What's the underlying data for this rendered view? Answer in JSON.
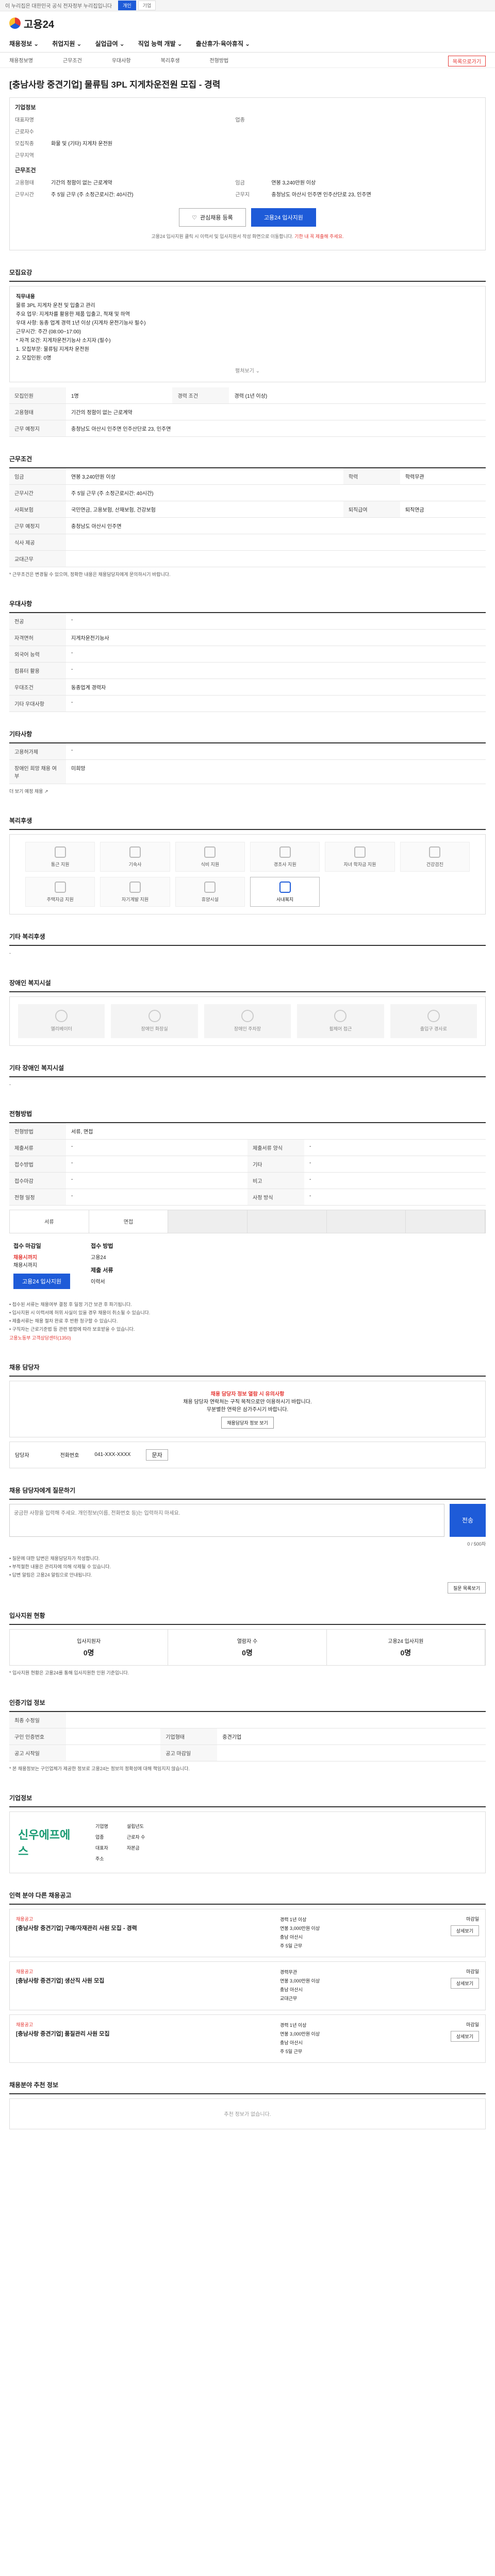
{
  "topbar": {
    "text": "이 누리집은 대한민국 공식 전자정부 누리집입니다",
    "tabs": [
      "개인",
      "기업"
    ]
  },
  "logo": "고용24",
  "gnb": [
    "채용정보",
    "취업지원",
    "실업급여",
    "직업 능력 개발",
    "출산휴가·육아휴직"
  ],
  "subnav": {
    "items": [
      "채용정보명",
      "근무조건",
      "우대사항",
      "복리후생",
      "전형방법"
    ],
    "cta": "목록으로가기"
  },
  "job_title": "[충남사랑 중견기업] 물류팀 3PL 지게차운전원 모집 - 경력",
  "summary": {
    "company_section": "기업정보",
    "rows": [
      {
        "k": "대표자명",
        "v": "",
        "k2": "업종",
        "v2": ""
      },
      {
        "k": "근로자수",
        "v": "",
        "k2": "",
        "v2": ""
      },
      {
        "k": "모집직종",
        "v": "화물 및 (기타) 지게차 운전원",
        "k2": "",
        "v2": ""
      },
      {
        "k": "근무지역",
        "v": "",
        "k2": "",
        "v2": ""
      }
    ],
    "cond_section": "근무조건",
    "cond_rows": [
      {
        "k": "고용형태",
        "v": "기간의 정함이 없는 근로계약",
        "k2": "임금",
        "v2": "연봉 3,240만원 이상"
      },
      {
        "k": "근무시간",
        "v": "주 5일 근무 (주 소정근로시간: 40시간)",
        "k2": "근무지",
        "v2": "충청남도 아산시 인주면 인주산단로 23, 인주면"
      }
    ]
  },
  "buttons": {
    "interest": "관심채용 등록",
    "apply": "고용24 입사지원"
  },
  "apply_note": "고용24 입사지원 클릭 시 이력서 및 입사지원서 작성 화면으로 이동합니다.",
  "apply_note_red": "기한 내 꼭 제출해 주세요.",
  "sections": {
    "recruit": "모집요강",
    "work": "근무조건",
    "preference": "우대사항",
    "welfare": "복리후생",
    "welfare_etc": "기타 복리후생",
    "disability": "장애인 복지시설",
    "disability_etc": "기타 장애인 복지시설",
    "process": "전형방법",
    "contact": "채용 담당자",
    "inquiry": "채용 담당자에게 질문하기",
    "stats": "입사지원 현황",
    "info": "인증기업 정보",
    "company": "기업정보",
    "other": "인력 분야 다른 채용공고",
    "recommend": "채용분야 추천 정보"
  },
  "recruit_box": {
    "lines": [
      "직무내용",
      "물류 3PL 지게차 운전 및 입출고 관리",
      "주요 업무: 지게차를 활용한 제품 입출고, 적재 및 하역",
      "우대 사항: 동종 업계 경력 1년 이상 (지게차 운전기능사 필수)",
      "근무시간: 주간 (08:00~17:00)",
      "* 자격 요건: 지게차운전기능사 소지자 (필수)",
      "1. 모집부문: 물류팀 지게차 운전원",
      "2. 모집인원: 0명"
    ],
    "more": "펼쳐보기"
  },
  "work_rows": [
    {
      "k": "모집인원",
      "v": "1명",
      "k2": "경력 조건",
      "v2": "경력 (1년 이상)"
    },
    {
      "k": "고용형태",
      "v": "기간의 정함이 없는 근로계약",
      "k2": "",
      "v2": ""
    },
    {
      "k": "근무 예정지",
      "v": "충청남도 아산시 인주면 인주산단로 23, 인주면",
      "k2": "",
      "v2": ""
    },
    {
      "k": "임금",
      "v": "연봉 3,240만원 이상",
      "k2": "학력",
      "v2": "학력무관"
    },
    {
      "k": "근무시간",
      "v": "주 5일 근무 (주 소정근로시간: 40시간)",
      "k2": "",
      "v2": ""
    },
    {
      "k": "사회보험",
      "v": "국민연금, 고용보험, 산재보험, 건강보험",
      "k2": "퇴직급여",
      "v2": "퇴직연금"
    },
    {
      "k": "근무 예정지",
      "v": "충청남도 아산시 인주면",
      "k2": "",
      "v2": ""
    },
    {
      "k": "식사 제공",
      "v": "",
      "k2": "",
      "v2": ""
    },
    {
      "k": "교대근무",
      "v": "",
      "k2": "",
      "v2": ""
    }
  ],
  "work_footnote": "* 근무조건은 변경될 수 있으며, 정확한 내용은 채용담당자에게 문의하시기 바랍니다.",
  "preference_rows": [
    {
      "k": "전공",
      "v": "-"
    },
    {
      "k": "자격면허",
      "v": "지게차운전기능사"
    },
    {
      "k": "외국어 능력",
      "v": "-"
    },
    {
      "k": "컴퓨터 활용",
      "v": "-"
    },
    {
      "k": "우대조건",
      "v": "동종업계 경력자"
    },
    {
      "k": "기타 우대사항",
      "v": "-"
    }
  ],
  "extra_section": "기타사항",
  "extra_rows": [
    {
      "k": "고용허가제",
      "v": "-"
    },
    {
      "k": "장애인 희망 채용 여부",
      "v": "미희망"
    }
  ],
  "extra_link": "더 보기 예정 채용",
  "welfare_items": [
    "통근 지원",
    "기숙사",
    "식비 지원",
    "경조사 지원",
    "자녀 학자금 지원",
    "건강검진",
    "주택자금 지원",
    "자기계발 지원",
    "휴양시설",
    "사내복지"
  ],
  "welfare_etc_value": "-",
  "disability_items": [
    "엘리베이터",
    "장애인 화장실",
    "장애인 주차장",
    "휠체어 접근",
    "출입구 경사로"
  ],
  "disability_etc_value": "-",
  "process": {
    "rows": [
      {
        "k": "전형방법",
        "v": "서류, 면접",
        "k2": "",
        "v2": ""
      },
      {
        "k": "제출서류",
        "v": "-",
        "k2": "제출서류 양식",
        "v2": "-"
      },
      {
        "k": "접수방법",
        "v": "-",
        "k2": "기타",
        "v2": "-"
      },
      {
        "k": "접수마감",
        "v": "-",
        "k2": "비고",
        "v2": "-"
      },
      {
        "k": "전형 일정",
        "v": "-",
        "k2": "사정 방식",
        "v2": "-"
      }
    ],
    "steps": [
      "서류",
      "면접",
      "",
      "",
      "",
      ""
    ]
  },
  "apply": {
    "period_label": "접수 마감일",
    "period_value": "채용시까지",
    "period_sub": "채용시까지",
    "method_label": "접수 방법",
    "method_value": "고용24",
    "submit_label": "제출 서류",
    "submit_value": "이력서",
    "btn": "고용24 입사지원"
  },
  "bullets": [
    "• 접수된 서류는 채용여부 결정 후 일정 기간 보관 후 파기됩니다.",
    "• 입사지원 시 이력서에 허위 사실이 있을 경우 채용이 취소될 수 있습니다.",
    "• 제출서류는 채용 절차 완료 후 반환 청구할 수 있습니다.",
    "• 구직자는 근로기준법 등 관련 법령에 따라 보호받을 수 있습니다."
  ],
  "bullet_red": "고용노동부 고객상담센터(1350)",
  "alert": {
    "red": "채용 담당자 정보 열람 시 유의사항",
    "text": "채용 담당자 연락처는 구직 목적으로만 이용하시기 바랍니다.",
    "text2": "무분별한 연락은 삼가주시기 바랍니다.",
    "btn": "채용담당자 정보 보기"
  },
  "contact": {
    "name_label": "담당자",
    "name_value": "",
    "phone_label": "전화번호",
    "phone_value": "041-XXX-XXXX",
    "btn": "문자"
  },
  "inquiry": {
    "placeholder": "궁금한 사항을 입력해 주세요. 개인정보(이름, 전화번호 등)는 입력하지 마세요.",
    "send": "전송",
    "counter": "0 / 500자",
    "notes": [
      "• 질문에 대한 답변은 채용담당자가 작성합니다.",
      "• 부적절한 내용은 관리자에 의해 삭제될 수 있습니다.",
      "• 답변 알림은 고용24 알림으로 안내됩니다."
    ],
    "btn": "질문 목록보기"
  },
  "stats": [
    {
      "label": "입사지원자",
      "value": "0명"
    },
    {
      "label": "열람자 수",
      "value": "0명"
    },
    {
      "label": "고용24 입사지원",
      "value": "0명"
    }
  ],
  "stats_note": "* 입사지원 현황은 고용24를 통해 입사지원한 인원 기준입니다.",
  "info_rows": [
    {
      "k": "최종 수정일",
      "v": "",
      "k2": "",
      "v2": ""
    },
    {
      "k": "구인 인증번호",
      "v": "",
      "k2": "기업형태",
      "v2": "중견기업"
    },
    {
      "k": "공고 시작일",
      "v": "",
      "k2": "공고 마감일",
      "v2": ""
    }
  ],
  "info_note": "* 본 채용정보는 구인업체가 제공한 정보로 고용24는 정보의 정확성에 대해 책임지지 않습니다.",
  "company": {
    "logo": "신우에프에스",
    "rows": [
      {
        "k": "기업명",
        "v": "",
        "k2": "설립년도",
        "v2": ""
      },
      {
        "k": "업종",
        "v": "",
        "k2": "근로자 수",
        "v2": ""
      },
      {
        "k": "대표자",
        "v": "",
        "k2": "자본금",
        "v2": ""
      },
      {
        "k": "주소",
        "v": "",
        "k2": "",
        "v2": ""
      }
    ]
  },
  "jobs": [
    {
      "co": "채용공고",
      "title": "[충남사랑 중견기업] 구매/자재관리 사원 모집 - 경력",
      "mid1": "경력 1년 이상",
      "mid2": "연봉 3,000만원 이상",
      "mid3": "충남 아산시",
      "mid4": "주 5일 근무",
      "status": "마감일",
      "btn": "상세보기"
    },
    {
      "co": "채용공고",
      "title": "[충남사랑 중견기업] 생산직 사원 모집",
      "mid1": "경력무관",
      "mid2": "연봉 3,000만원 이상",
      "mid3": "충남 아산시",
      "mid4": "교대근무",
      "status": "마감일",
      "btn": "상세보기"
    },
    {
      "co": "채용공고",
      "title": "[충남사랑 중견기업] 품질관리 사원 모집",
      "mid1": "경력 1년 이상",
      "mid2": "연봉 3,000만원 이상",
      "mid3": "충남 아산시",
      "mid4": "주 5일 근무",
      "status": "마감일",
      "btn": "상세보기"
    }
  ],
  "recommend_empty": "추천 정보가 없습니다."
}
